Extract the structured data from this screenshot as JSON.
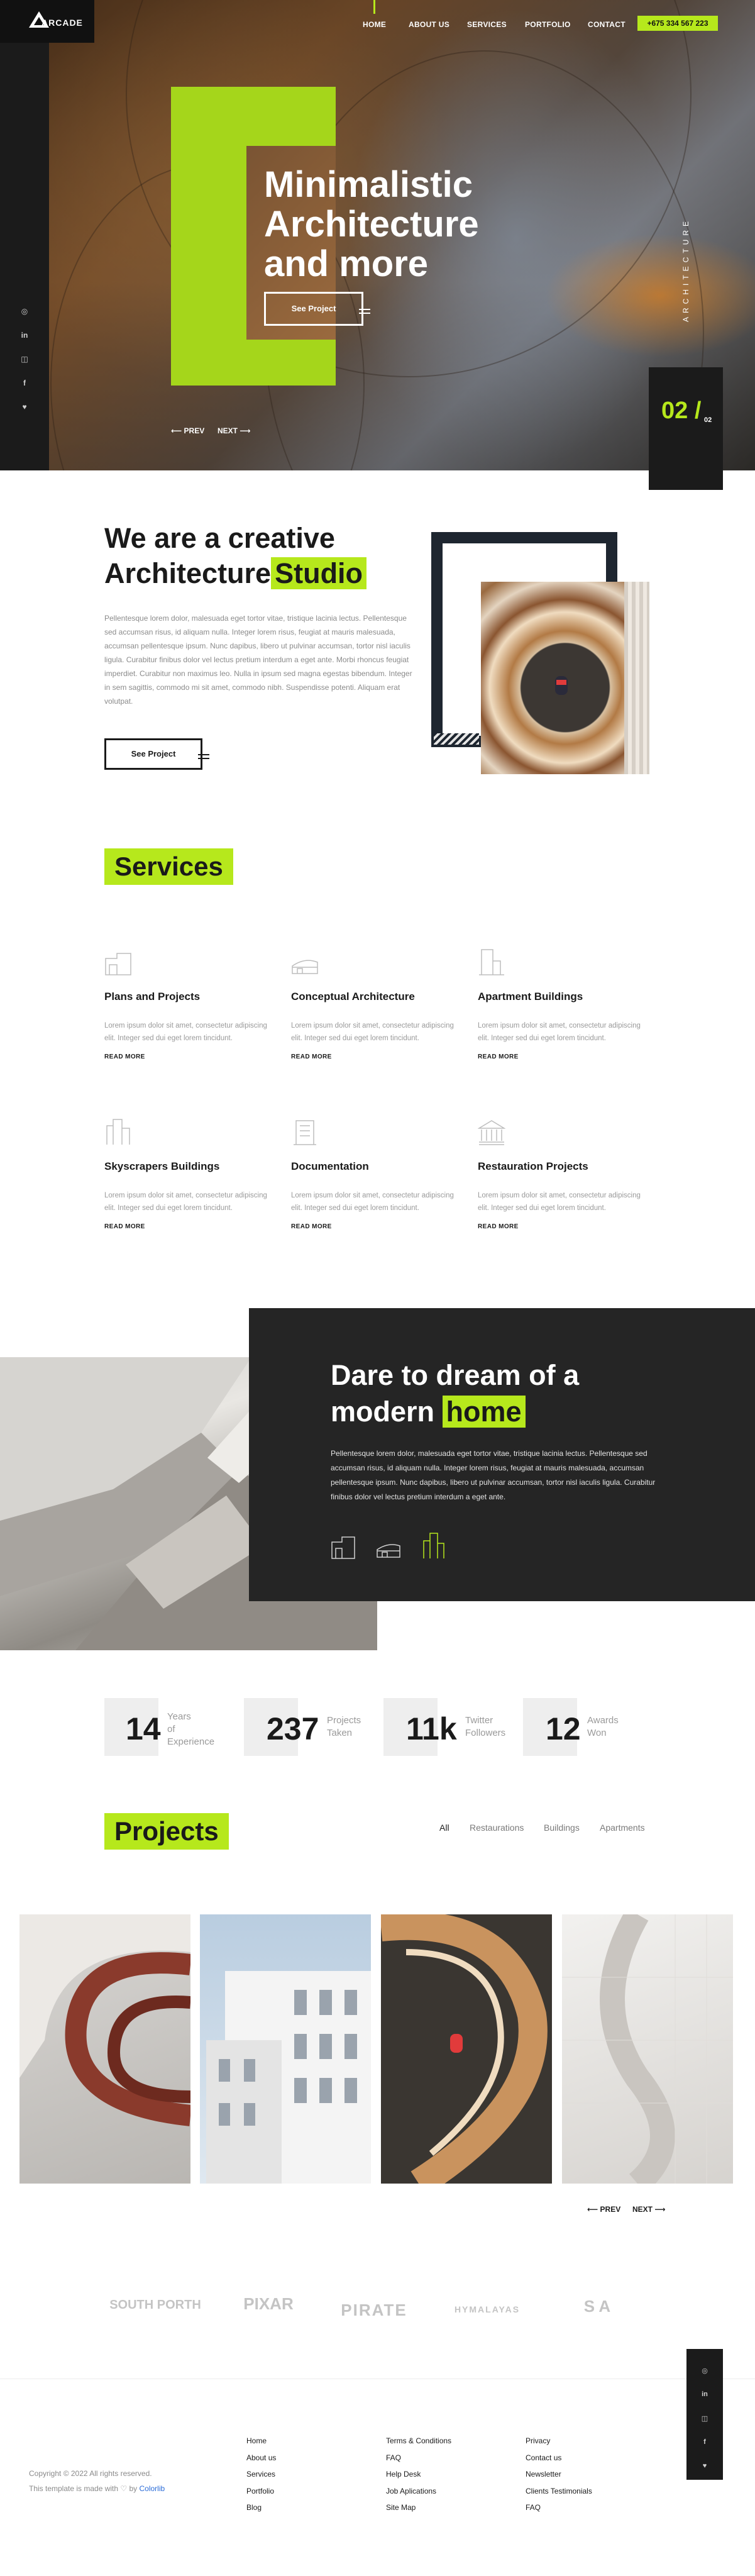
{
  "brand": {
    "name": "ARCADE"
  },
  "colors": {
    "accent": "#b6e81c",
    "dark": "#1b1b1b"
  },
  "nav": {
    "items": [
      "HOME",
      "ABOUT US",
      "SERVICES",
      "PORTFOLIO",
      "CONTACT"
    ],
    "phone": "+675 334 567 223"
  },
  "social_icons": [
    "dribbble-icon",
    "linkedin-icon",
    "instagram-icon",
    "facebook-icon",
    "twitter-icon"
  ],
  "hero": {
    "title_line1": "Minimalistic",
    "title_line2": "Architecture",
    "title_line3": "and more",
    "button": "See Project",
    "prev": "PREV",
    "next": "NEXT",
    "vertical_label": "ARCHITECTURE",
    "slide_current": "02 /",
    "slide_total": "02"
  },
  "about": {
    "title_line1": "We are a creative",
    "title_word": "Architecture",
    "title_highlight": "Studio",
    "text": "Pellentesque lorem dolor, malesuada eget tortor vitae, tristique lacinia lectus. Pellentesque sed accumsan risus, id aliquam nulla. Integer lorem risus, feugiat at mauris malesuada, accumsan pellentesque ipsum. Nunc dapibus, libero ut pulvinar accumsan, tortor nisl iaculis ligula. Curabitur finibus dolor vel lectus pretium interdum a eget ante. Morbi rhoncus feugiat imperdiet. Curabitur non maximus leo. Nulla in ipsum sed magna egestas bibendum. Integer in sem sagittis, commodo mi sit amet, commodo nibh. Suspendisse potenti. Aliquam erat volutpat.",
    "button": "See Project"
  },
  "services": {
    "heading": "Services",
    "items": [
      {
        "icon": "house-icon",
        "title": "Plans and Projects",
        "text": "Lorem ipsum dolor sit amet, consectetur adipiscing elit. Integer sed dui eget lorem tincidunt.",
        "link": "READ MORE"
      },
      {
        "icon": "bridge-icon",
        "title": "Conceptual Architecture",
        "text": "Lorem ipsum dolor sit amet, consectetur adipiscing elit. Integer sed dui eget lorem tincidunt.",
        "link": "READ MORE"
      },
      {
        "icon": "apartment-icon",
        "title": "Apartment Buildings",
        "text": "Lorem ipsum dolor sit amet, consectetur adipiscing elit. Integer sed dui eget lorem tincidunt.",
        "link": "READ MORE"
      },
      {
        "icon": "skyscraper-icon",
        "title": "Skyscrapers Buildings",
        "text": "Lorem ipsum dolor sit amet, consectetur adipiscing elit. Integer sed dui eget lorem tincidunt.",
        "link": "READ MORE"
      },
      {
        "icon": "document-icon",
        "title": "Documentation",
        "text": "Lorem ipsum dolor sit amet, consectetur adipiscing elit. Integer sed dui eget lorem tincidunt.",
        "link": "READ MORE"
      },
      {
        "icon": "museum-icon",
        "title": "Restauration Projects",
        "text": "Lorem ipsum dolor sit amet, consectetur adipiscing elit. Integer sed dui eget lorem tincidunt.",
        "link": "READ MORE"
      }
    ]
  },
  "dream": {
    "title_line1": "Dare to dream of a",
    "title_word": "modern",
    "title_highlight": "home",
    "text": "Pellentesque lorem dolor, malesuada eget tortor vitae, tristique lacinia lectus. Pellentesque sed accumsan risus, id aliquam nulla. Integer lorem risus, feugiat at mauris malesuada, accumsan pellentesque ipsum. Nunc dapibus, libero ut pulvinar accumsan, tortor nisl iaculis ligula. Curabitur finibus dolor vel lectus pretium interdum a eget ante.",
    "icons": [
      "house-icon",
      "bridge-icon",
      "skyscraper-icon"
    ]
  },
  "stats": [
    {
      "value": "14",
      "label_line1": "Years",
      "label_line2": "of",
      "label_line3": "Experience"
    },
    {
      "value": "237",
      "label_line1": "Projects",
      "label_line2": "Taken"
    },
    {
      "value": "11k",
      "label_line1": "Twitter",
      "label_line2": "Followers"
    },
    {
      "value": "12",
      "label_line1": "Awards",
      "label_line2": "Won"
    }
  ],
  "projects": {
    "heading": "Projects",
    "filters": [
      "All",
      "Restaurations",
      "Buildings",
      "Apartments"
    ],
    "prev": "PREV",
    "next": "NEXT"
  },
  "clients": [
    "SOUTH PORTH",
    "PIXAR",
    "PIRATE",
    "HYMALAYAS",
    "S A"
  ],
  "footer": {
    "copyright": "Copyright © 2022 All rights reserved.",
    "made_with": "This template is made with ♡ by",
    "made_by": "Colorlib",
    "col1": [
      "Home",
      "About us",
      "Services",
      "Portfolio",
      "Blog"
    ],
    "col2": [
      "Terms & Conditions",
      "FAQ",
      "Help Desk",
      "Job Aplications",
      "Site Map"
    ],
    "col3": [
      "Privacy",
      "Contact us",
      "Newsletter",
      "Clients Testimonials",
      "FAQ"
    ]
  }
}
